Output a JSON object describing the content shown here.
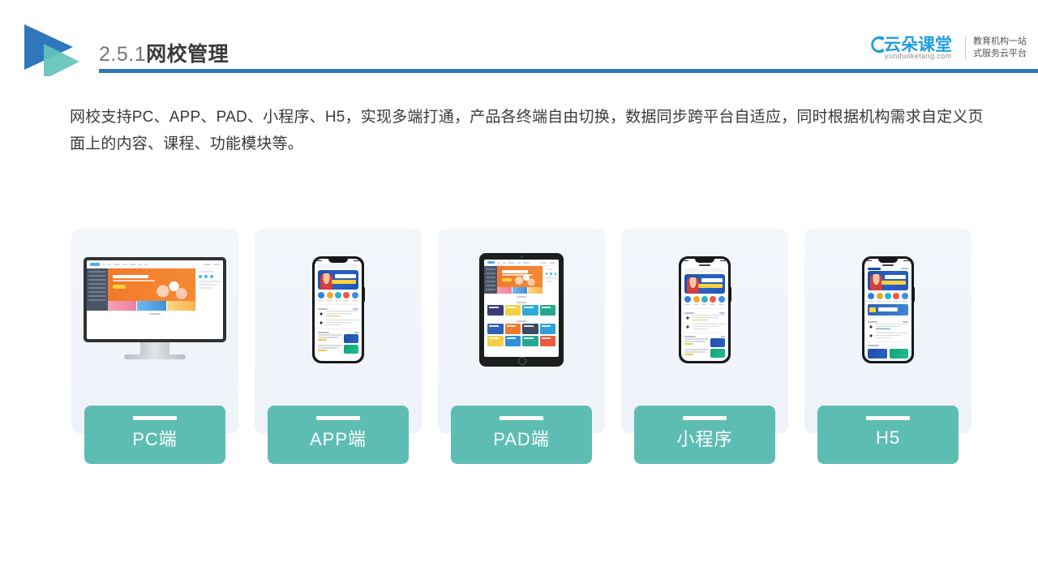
{
  "header": {
    "section_number": "2.5.1",
    "section_title": "网校管理",
    "rule_color": "#3076b8",
    "logo_mark_colors": [
      "#2e77bd",
      "#63c3bb"
    ]
  },
  "corp_logo": {
    "name": "云朵课堂",
    "url": "yunduoketang.com",
    "tagline_line1": "教育机构一站",
    "tagline_line2": "式服务云平台",
    "brand_color": "#1f9fe0"
  },
  "intro": {
    "paragraph": "网校支持PC、APP、PAD、小程序、H5，实现多端打通，产品各终端自由切换，数据同步跨平台自适应，同时根据机构需求自定义页面上的内容、课程、功能模块等。"
  },
  "cards": [
    {
      "label": "PC端",
      "device": "desktop",
      "card_bg": "#f2f5fa",
      "button_color": "#5dbdb3"
    },
    {
      "label": "APP端",
      "device": "phone",
      "card_bg": "#f2f5fa",
      "button_color": "#5dbdb3"
    },
    {
      "label": "PAD端",
      "device": "tablet",
      "card_bg": "#f2f5fa",
      "button_color": "#5dbdb3"
    },
    {
      "label": "小程序",
      "device": "phone",
      "card_bg": "#f2f5fa",
      "button_color": "#5dbdb3"
    },
    {
      "label": "H5",
      "device": "phone",
      "card_bg": "#f2f5fa",
      "button_color": "#5dbdb3"
    }
  ]
}
